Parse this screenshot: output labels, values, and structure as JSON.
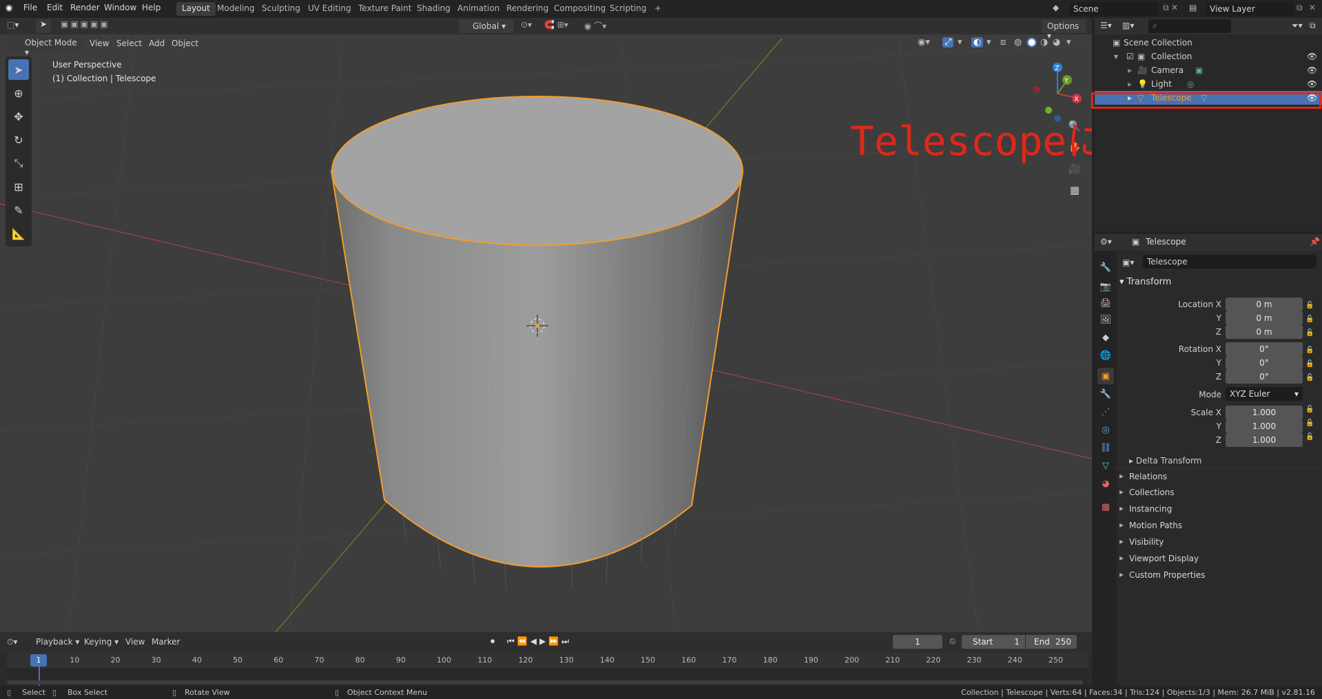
{
  "menu": {
    "file": "File",
    "edit": "Edit",
    "render": "Render",
    "window": "Window",
    "help": "Help"
  },
  "workspaces": [
    "Layout",
    "Modeling",
    "Sculpting",
    "UV Editing",
    "Texture Paint",
    "Shading",
    "Animation",
    "Rendering",
    "Compositing",
    "Scripting"
  ],
  "add_workspace": "+",
  "scene": {
    "name": "Scene"
  },
  "view_layer": {
    "name": "View Layer"
  },
  "viewport_header": {
    "mode": "Object Mode",
    "view": "View",
    "select": "Select",
    "add": "Add",
    "object": "Object",
    "transform_orientation": "Global",
    "options": "Options"
  },
  "viewport_info": {
    "line1": "User Perspective",
    "line2": "(1) Collection | Telescope"
  },
  "gizmo_axes": {
    "x": "X",
    "y": "Y",
    "z": "Z"
  },
  "annotation": {
    "text": "Telescopeにリネーム",
    "color": "#e0271a"
  },
  "outliner": {
    "search_placeholder": "",
    "root": "Scene Collection",
    "collection": "Collection",
    "items": [
      {
        "label": "Camera"
      },
      {
        "label": "Light"
      },
      {
        "label": "Telescope",
        "selected": true
      }
    ]
  },
  "properties": {
    "header_object": "Telescope",
    "object_name": "Telescope",
    "transform_label": "Transform",
    "location": {
      "label_x": "Location X",
      "label_y": "Y",
      "label_z": "Z",
      "x": "0 m",
      "y": "0 m",
      "z": "0 m"
    },
    "rotation": {
      "label_x": "Rotation X",
      "label_y": "Y",
      "label_z": "Z",
      "x": "0°",
      "y": "0°",
      "z": "0°"
    },
    "mode": {
      "label": "Mode",
      "value": "XYZ Euler"
    },
    "scale": {
      "label_x": "Scale X",
      "label_y": "Y",
      "label_z": "Z",
      "x": "1.000",
      "y": "1.000",
      "z": "1.000"
    },
    "delta_transform": "Delta Transform",
    "panels": [
      "Relations",
      "Collections",
      "Instancing",
      "Motion Paths",
      "Visibility",
      "Viewport Display",
      "Custom Properties"
    ]
  },
  "timeline": {
    "playback": "Playback",
    "keying": "Keying",
    "view": "View",
    "marker": "Marker",
    "current_frame": "1",
    "start_label": "Start",
    "start": "1",
    "end_label": "End",
    "end": "250",
    "ruler": [
      "1",
      "10",
      "20",
      "30",
      "40",
      "50",
      "60",
      "70",
      "80",
      "90",
      "100",
      "110",
      "120",
      "130",
      "140",
      "150",
      "160",
      "170",
      "180",
      "190",
      "200",
      "210",
      "220",
      "230",
      "240",
      "250"
    ]
  },
  "statusbar": {
    "select": "Select",
    "box_select": "Box Select",
    "rotate_view": "Rotate View",
    "context_menu": "Object Context Menu",
    "stats": "Collection | Telescope | Verts:64 | Faces:34 | Tris:124 | Objects:1/3 | Mem: 26.7 MiB | v2.81.16"
  },
  "colors": {
    "accent": "#4772b3",
    "selection": "#f39c2d",
    "x_axis": "#c8363f",
    "y_axis": "#6a9a25",
    "z_axis": "#2c7fd4"
  }
}
